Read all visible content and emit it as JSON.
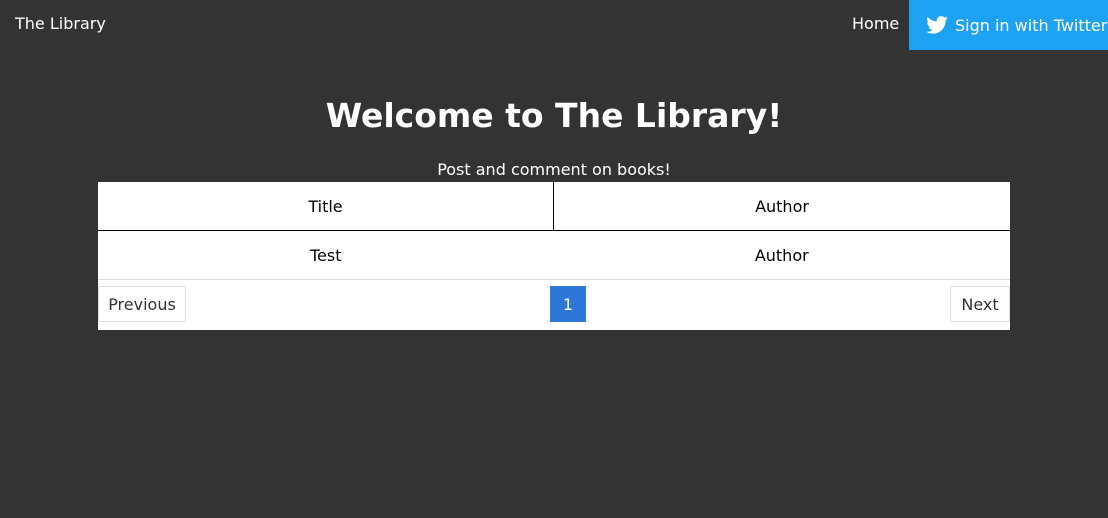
{
  "navbar": {
    "brand": "The Library",
    "home_label": "Home",
    "twitter_label": "Sign in with Twitter"
  },
  "main": {
    "heading": "Welcome to The Library!",
    "subtitle": "Post and comment on books!"
  },
  "table": {
    "headers": [
      "Title",
      "Author"
    ],
    "rows": [
      [
        "Test",
        "Author"
      ]
    ]
  },
  "pagination": {
    "previous_label": "Previous",
    "current_page": "1",
    "next_label": "Next"
  },
  "colors": {
    "background": "#333333",
    "twitter_blue": "#1da1f2",
    "active_page": "#2f77d6"
  },
  "icons": {
    "twitter": "twitter-bird-icon"
  }
}
